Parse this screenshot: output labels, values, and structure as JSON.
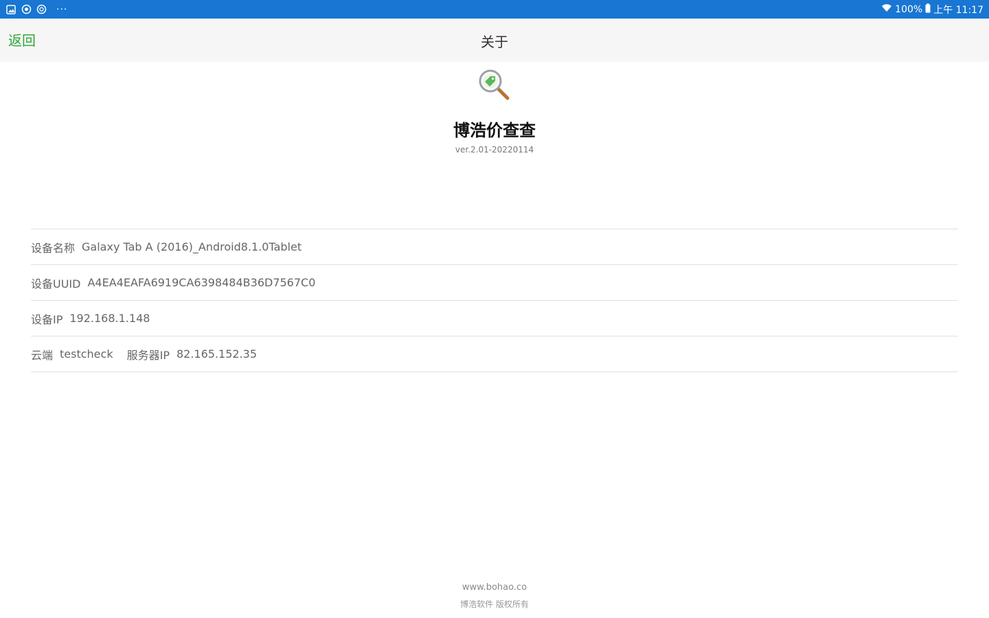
{
  "status_bar": {
    "signal_icon": "wifi-icon",
    "battery_percent": "100%",
    "time": "上午 11:17",
    "notification_icons": [
      "gallery-icon",
      "circle-icon",
      "circle-icon"
    ],
    "more": "···",
    "bg_color": "#1976d2"
  },
  "nav": {
    "back_label": "返回",
    "title": "关于",
    "back_color": "#2ea63a"
  },
  "app": {
    "logo_icon": "magnifier-tag-icon",
    "name": "博浩价查查",
    "version": "ver.2.01-20220114"
  },
  "info": {
    "device_name_label": "设备名称",
    "device_name_value": "Galaxy Tab A (2016)_Android8.1.0Tablet",
    "uuid_label": "设备UUID",
    "uuid_value": "A4EA4EAFA6919CA6398484B36D7567C0",
    "ip_label": "设备IP",
    "ip_value": "192.168.1.148",
    "cloud_label": "云端",
    "cloud_value": "testcheck",
    "server_ip_label": "服务器IP",
    "server_ip_value": "82.165.152.35"
  },
  "footer": {
    "url": "www.bohao.co",
    "copyright": "博浩软件 版权所有"
  }
}
